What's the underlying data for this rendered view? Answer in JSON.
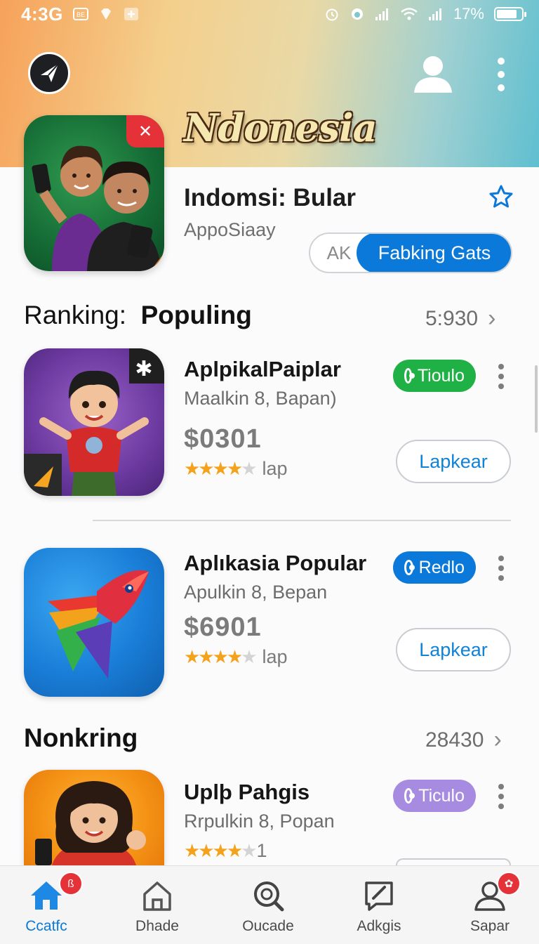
{
  "status_bar": {
    "time": "4:3G",
    "battery_text": "17%"
  },
  "header": {
    "brand_title": "Ndonesia"
  },
  "featured": {
    "name": "Indomsi: Bular",
    "subtitle": "AppoSiaay",
    "segment_left": "AK",
    "segment_right": "Fabking Gats",
    "close_glyph": "✕"
  },
  "section_ranking": {
    "title_prefix": "Ranking:",
    "title_bold": "Populing",
    "count": "5:930",
    "chevron": "›"
  },
  "apps": [
    {
      "title": "AplpikalPaiplar",
      "subtitle": "Maalkin 8, Bapan)",
      "price": "$0301",
      "rating_stars": 4,
      "rating_label": "lap",
      "tag": "Tioulo",
      "tag_color": "#1fb145",
      "action": "Lapkear",
      "corner_glyph": "✱"
    },
    {
      "title": "Aplıkasia Popular",
      "subtitle": "Apulkin 8, Bepan",
      "price": "$6901",
      "rating_stars": 4,
      "rating_label": "lap",
      "tag": "Redlo",
      "tag_color": "#0b79d9",
      "action": "Lapkear"
    },
    {
      "title": "Uplþ Pahgis",
      "subtitle": "Rrpulkin 8, Popan",
      "rating_stars": 4,
      "rating_label": "1",
      "tag": "Ticulo",
      "tag_color": "#a78be0"
    }
  ],
  "section_nonkring": {
    "title": "Nonkring",
    "count": "28430",
    "chevron": "›"
  },
  "bottom_nav": [
    {
      "label": "Ccatfc",
      "icon": "home-icon",
      "badge": "ß"
    },
    {
      "label": "Dhade",
      "icon": "house-outline-icon"
    },
    {
      "label": "Oucade",
      "icon": "search-icon"
    },
    {
      "label": "Adkgis",
      "icon": "edit-icon"
    },
    {
      "label": "Sapar",
      "icon": "profile-icon",
      "badge": "✿"
    }
  ],
  "colors": {
    "accent_blue": "#0b79d9",
    "badge_red": "#e53238",
    "star_gold": "#f3a21b"
  }
}
